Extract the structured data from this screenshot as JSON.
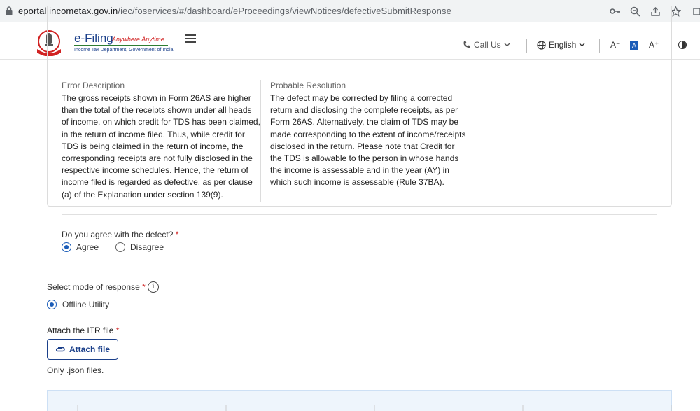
{
  "browser": {
    "url_host": "eportal.incometax.gov.in",
    "url_path": "/iec/foservices/#/dashboard/eProceedings/viewNotices/defectiveSubmitResponse"
  },
  "header": {
    "logo_title": "e-Filing",
    "logo_tagline": "Anywhere Anytime",
    "logo_subtitle": "Income Tax Department, Government of India",
    "call_us": "Call Us",
    "language": "English",
    "font_decrease": "A⁻",
    "font_normal": "A",
    "font_increase": "A⁺"
  },
  "defect": {
    "error_heading": "Error Description",
    "error_lines": [
      "The gross receipts shown in Form 26AS are higher",
      "than the total of the receipts shown under all heads",
      "of income, on which credit for TDS has been claimed,",
      "in the return of income filed. Thus, while credit for",
      "TDS is being claimed in the return of income, the",
      "corresponding receipts are not fully disclosed in the",
      "respective income schedules. Hence, the return of",
      "income filed is regarded as defective, as per clause",
      "(a) of the Explanation under section 139(9)."
    ],
    "resolution_heading": "Probable Resolution",
    "resolution_lines": [
      "The defect may be corrected by filing a corrected",
      "return and disclosing the complete receipts, as per",
      "Form 26AS. Alternatively, the claim of TDS may be",
      "made corresponding to the extent of income/receipts",
      "disclosed in the return. Please note that Credit for",
      "the TDS is allowable to the person in whose hands",
      "the income is assessable and in the year (AY) in",
      "which such income is assessable (Rule 37BA)."
    ]
  },
  "agree_question": {
    "label": "Do you agree with the defect?",
    "required_mark": "*",
    "options": [
      "Agree",
      "Disagree"
    ],
    "selected": "Agree"
  },
  "response_mode": {
    "label": "Select mode of response",
    "required_mark": "*",
    "option": "Offline Utility"
  },
  "attach": {
    "label": "Attach the ITR file",
    "required_mark": "*",
    "button_label": "Attach file",
    "hint": "Only .json files."
  },
  "colors": {
    "primary": "#1a5cb8",
    "brand_navy": "#1a3f8a",
    "required": "#d32f2f"
  }
}
